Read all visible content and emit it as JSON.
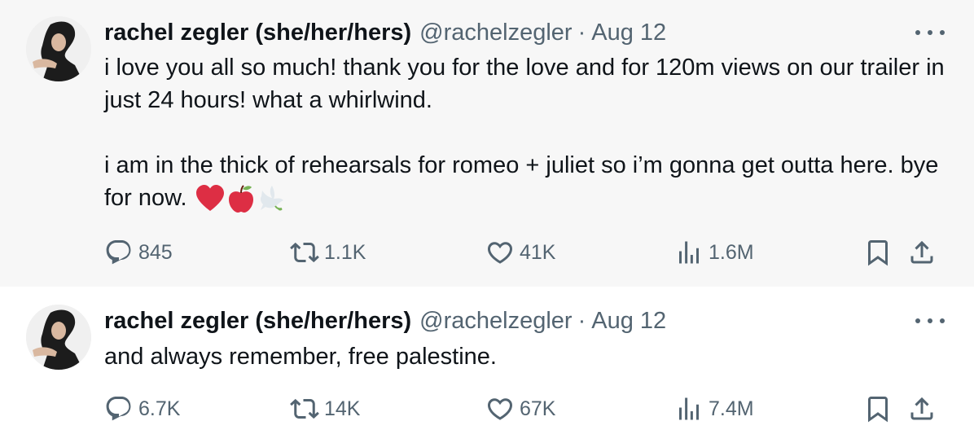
{
  "tweets": [
    {
      "author_name": "rachel zegler (she/her/hers)",
      "handle": "@rachelzegler",
      "separator": "·",
      "date": "Aug 12",
      "paragraphs": [
        "i love you all so much! thank you for the love and for 120m views on our trailer in just 24 hours! what a whirlwind.",
        "i am in the thick of rehearsals for romeo + juliet so i’m gonna get outta here. bye for now."
      ],
      "emojis": [
        "red-heart",
        "red-apple",
        "dove"
      ],
      "stats": {
        "replies": "845",
        "reposts": "1.1K",
        "likes": "41K",
        "views": "1.6M"
      }
    },
    {
      "author_name": "rachel zegler (she/her/hers)",
      "handle": "@rachelzegler",
      "separator": "·",
      "date": "Aug 12",
      "paragraphs": [
        "and always remember, free palestine."
      ],
      "stats": {
        "replies": "6.7K",
        "reposts": "14K",
        "likes": "67K",
        "views": "7.4M"
      }
    }
  ],
  "icons": {
    "reply": "reply-icon",
    "repost": "repost-icon",
    "like": "heart-icon",
    "views": "views-icon",
    "bookmark": "bookmark-icon",
    "share": "share-icon",
    "more": "more-icon"
  },
  "colors": {
    "text": "#0f1419",
    "muted": "#536471",
    "thread_line": "#cfd9de",
    "highlight_bg": "#f7f7f7"
  }
}
